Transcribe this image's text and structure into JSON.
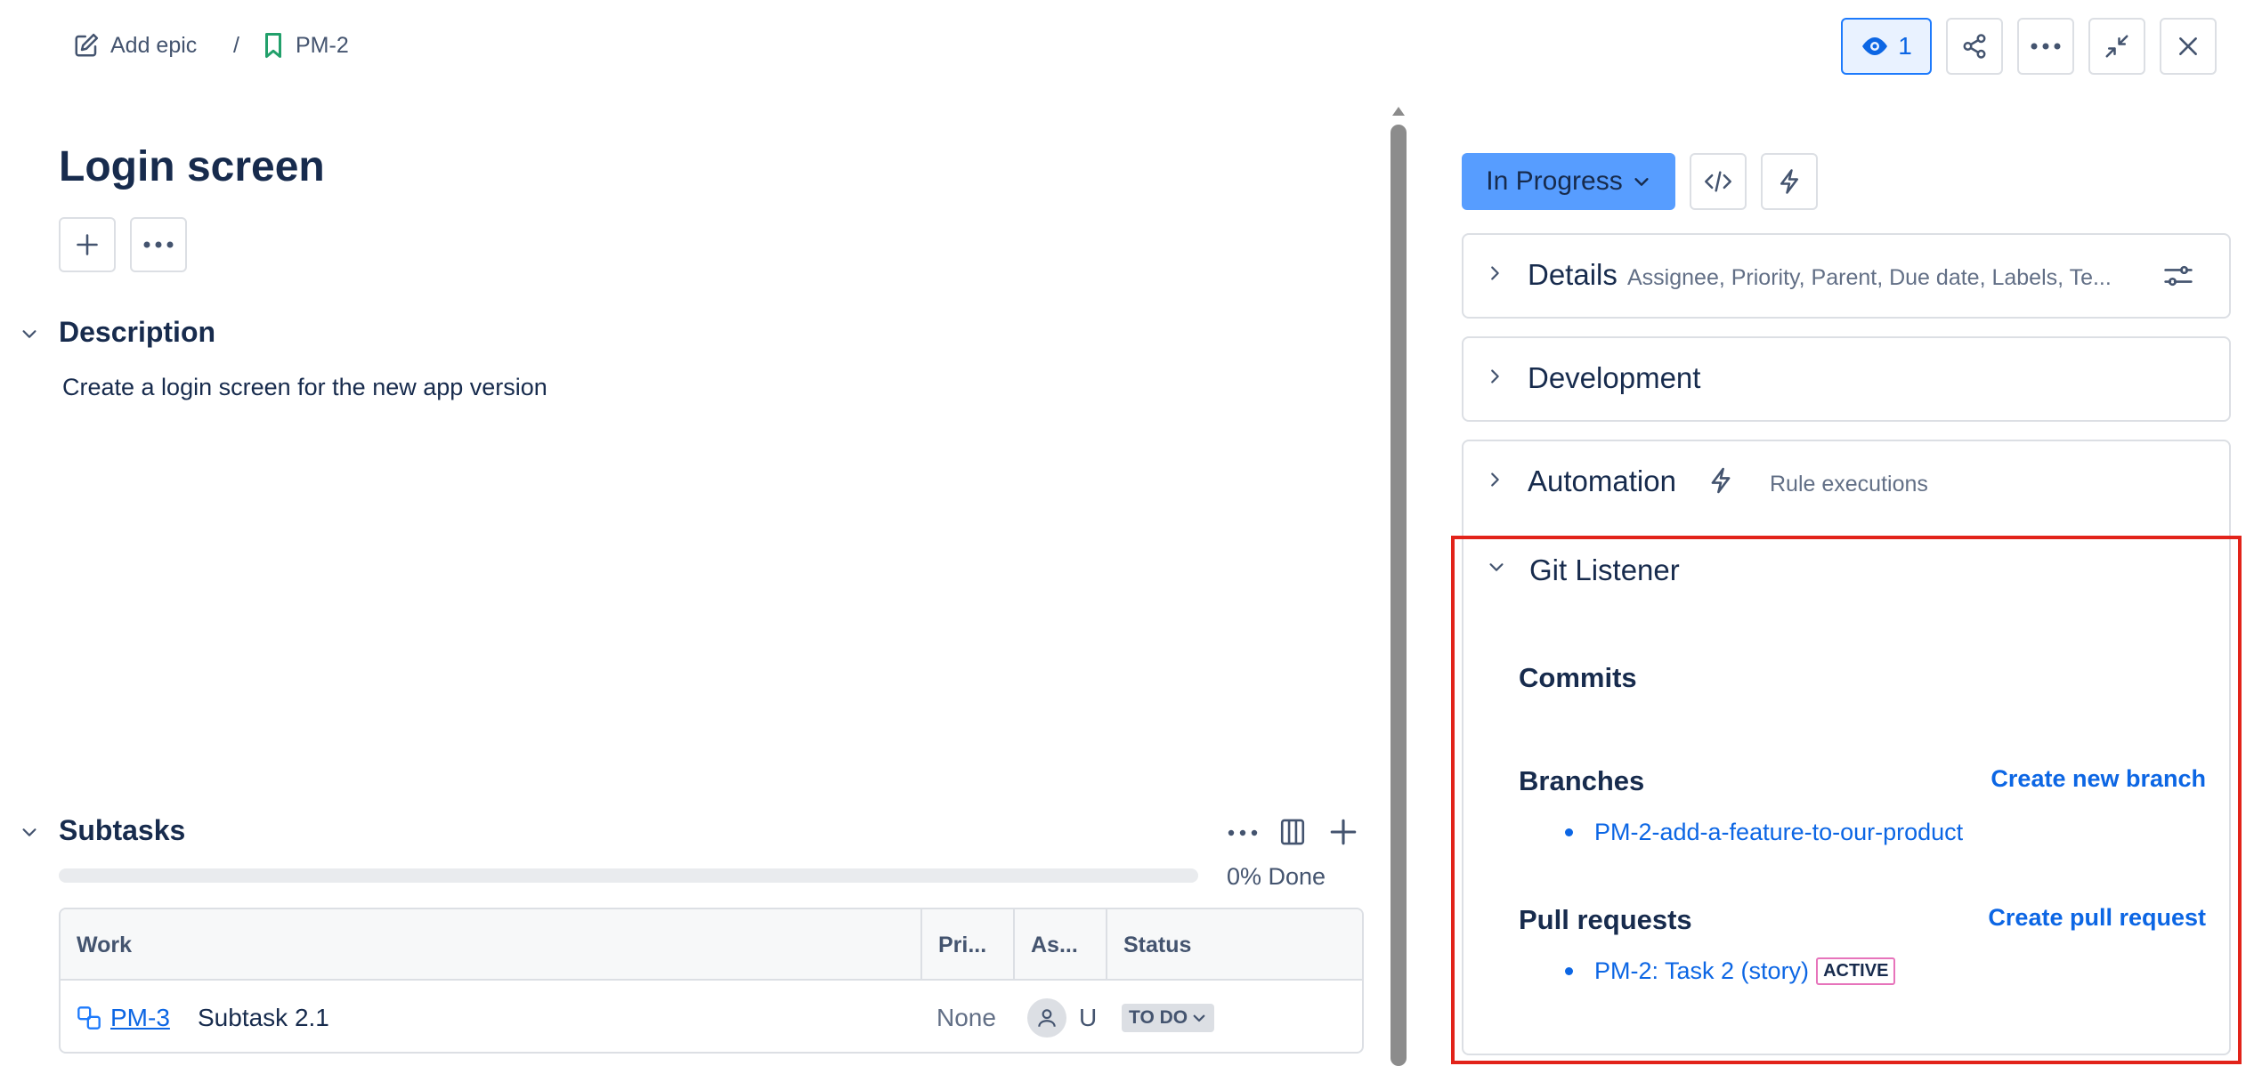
{
  "breadcrumb": {
    "add_epic": "Add epic",
    "separator": "/",
    "issue_key": "PM-2"
  },
  "header": {
    "watchers_count": "1"
  },
  "issue": {
    "title": "Login screen",
    "description_heading": "Description",
    "description_text": "Create a login screen for the new app version",
    "status": "In Progress"
  },
  "subtasks": {
    "heading": "Subtasks",
    "progress_label": "0% Done",
    "progress_fraction": 0,
    "columns": [
      "Work",
      "Pri...",
      "As...",
      "Status"
    ],
    "rows": [
      {
        "key": "PM-3",
        "summary": "Subtask 2.1",
        "priority": "None",
        "assignee": "U",
        "status": "TO DO"
      }
    ]
  },
  "details": {
    "title": "Details",
    "subtitle": "Assignee, Priority, Parent, Due date, Labels, Te..."
  },
  "development": {
    "title": "Development"
  },
  "automation": {
    "title": "Automation",
    "subtitle": "Rule executions"
  },
  "git_listener": {
    "title": "Git Listener",
    "commits_heading": "Commits",
    "branches_heading": "Branches",
    "create_branch": "Create new branch",
    "branches": [
      "PM-2-add-a-feature-to-our-product"
    ],
    "pull_requests_heading": "Pull requests",
    "create_pr": "Create pull request",
    "pull_requests": [
      {
        "title": "PM-2: Task 2 (story)",
        "state": "ACTIVE"
      }
    ]
  },
  "colors": {
    "accent": "#0c66e4",
    "status_button": "#579dff",
    "highlight_border": "#e2231a"
  }
}
